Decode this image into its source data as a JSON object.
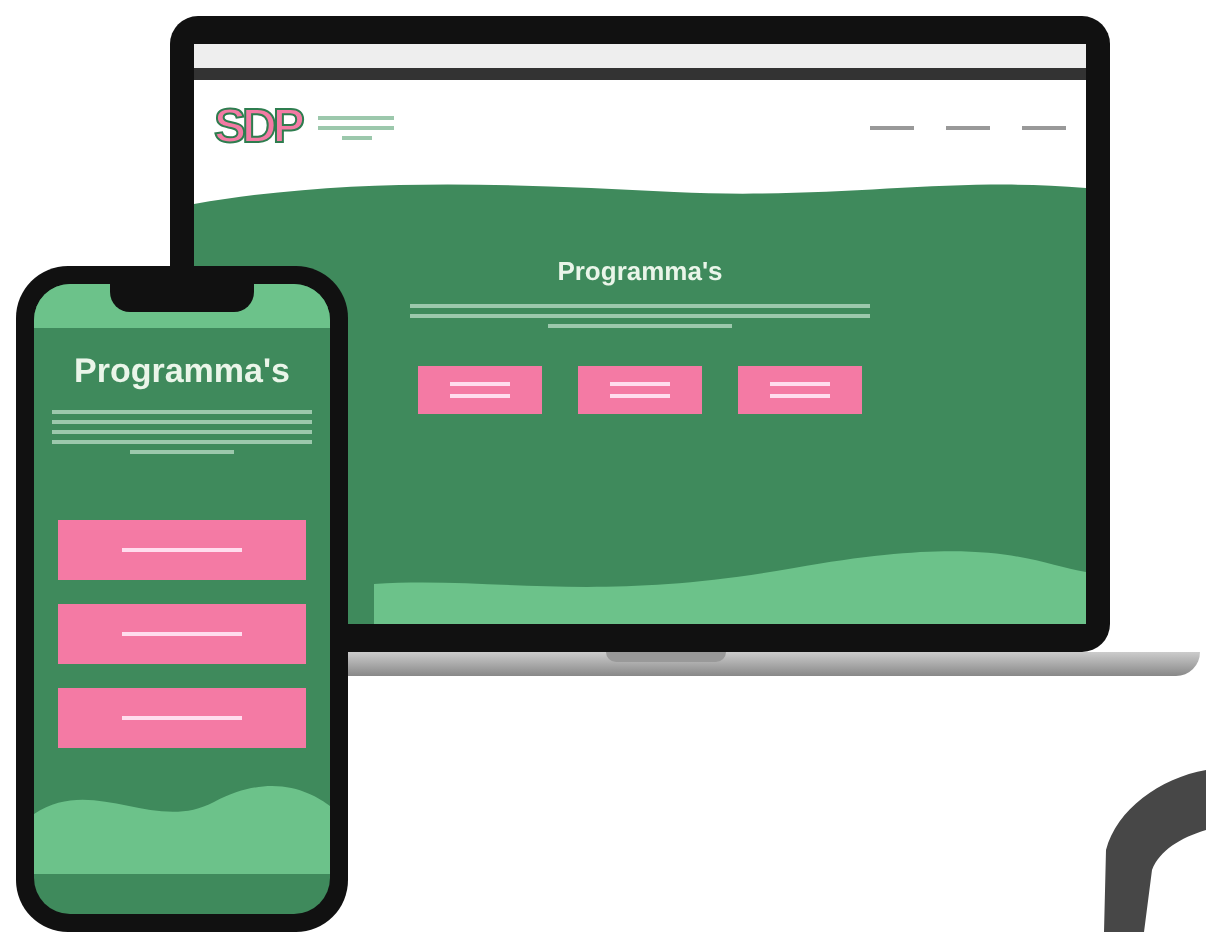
{
  "laptop": {
    "logo": "SDP",
    "heading": "Programma's"
  },
  "phone": {
    "heading": "Programma's"
  }
}
